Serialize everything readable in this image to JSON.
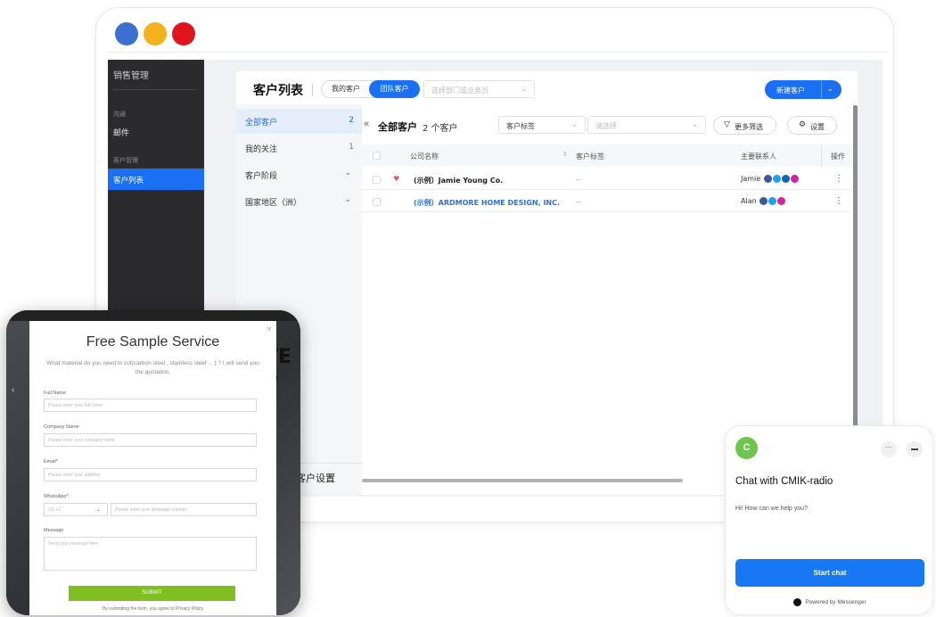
{
  "window": {
    "dots": [
      "#3d6fd0",
      "#f3b21b",
      "#e0141b"
    ]
  },
  "sidebar": {
    "title": "销售管理",
    "group1_label": "沟通",
    "group1_item": "邮件",
    "group2_label": "客户管理",
    "active_item": "客户列表"
  },
  "header": {
    "title": "客户列表",
    "tabs": [
      "我的客户",
      "团队客户"
    ],
    "active_tab": "团队客户",
    "dept_placeholder": "选择部门或业务员",
    "new_customer_label": "新建客户"
  },
  "left_tabs": [
    {
      "label": "全部客户",
      "count": "2",
      "active": true
    },
    {
      "label": "我的关注",
      "count": "1"
    },
    {
      "label": "客户阶段",
      "chevron": true
    },
    {
      "label": "国家地区（洲）",
      "chevron": true
    }
  ],
  "left_footer": "客户设置",
  "filter_bar": {
    "title": "全部客户",
    "count": "2 个客户",
    "tag_select": "客户标签",
    "value_placeholder": "请选择",
    "more_filters": "更多筛选",
    "settings": "设置"
  },
  "table": {
    "headers": [
      "公司名称",
      "客户标签",
      "主要联系人",
      "操作"
    ],
    "rows": [
      {
        "company": "(示例）Jamie Young Co.",
        "tag": "--",
        "contact": "Jamie",
        "favorite": true,
        "link": false
      },
      {
        "company": "(示例）ARDMORE HOME DESIGN, INC.",
        "tag": "--",
        "contact": "Alan",
        "favorite": false,
        "link": true
      }
    ],
    "menu_glyph": "⋮"
  },
  "popup_form": {
    "bg_text": "TE\nS",
    "title": "Free Sample Service",
    "subtitle": "What material do you need to cut(carbon steel , stainless steel ... ) ? I will send you the quotation.",
    "fields": [
      {
        "label": "Full Name",
        "placeholder": "Please enter your full name"
      },
      {
        "label": "Company Name",
        "placeholder": "Please enter your company name"
      },
      {
        "label": "Email*",
        "placeholder": "Please enter your address"
      },
      {
        "label": "WhatsApp*",
        "placeholder": "Please enter your whatsapp number",
        "prefix": "US +1"
      },
      {
        "label": "Message",
        "placeholder": "Send your message here"
      }
    ],
    "submit_label": "SUBMIT",
    "footer": "By submitting the form, you agree to Privacy Policy"
  },
  "chat": {
    "avatar_letter": "C",
    "more": "···",
    "title": "Chat with CMIK-radio",
    "message": "Hi! How can we help you?",
    "button": "Start chat",
    "footer": "Powered by Messenger"
  }
}
